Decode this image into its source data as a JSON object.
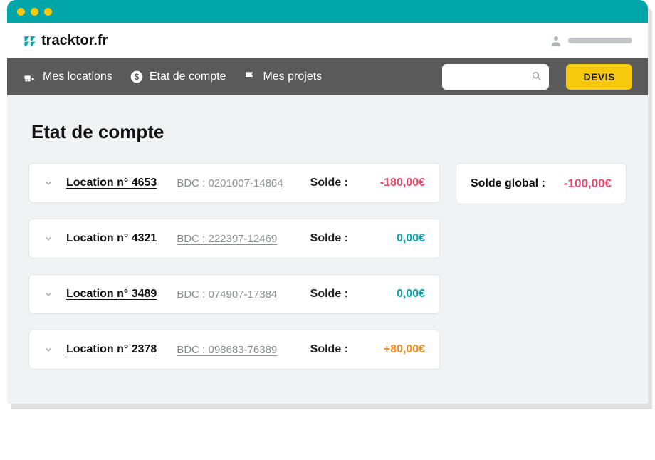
{
  "brand": "tracktor.fr",
  "nav": {
    "locations": "Mes locations",
    "compte": "Etat de compte",
    "projets": "Mes projets",
    "devis": "DEVIS",
    "search_placeholder": ""
  },
  "page_title": "Etat de compte",
  "global": {
    "label": "Solde global :",
    "value": "-100,00€"
  },
  "solde_label": "Solde :",
  "rows": [
    {
      "name": "Location n° 4653",
      "bdc": "BDC : 0201007-14864",
      "solde": "-180,00€",
      "cls": "neg"
    },
    {
      "name": "Location n° 4321",
      "bdc": "BDC : 222397-12469",
      "solde": "0,00€",
      "cls": "zero"
    },
    {
      "name": "Location n° 3489",
      "bdc": "BDC : 074907-17384",
      "solde": "0,00€",
      "cls": "zero"
    },
    {
      "name": "Location n° 2378",
      "bdc": "BDC : 098683-76389",
      "solde": "+80,00€",
      "cls": "pos"
    }
  ]
}
